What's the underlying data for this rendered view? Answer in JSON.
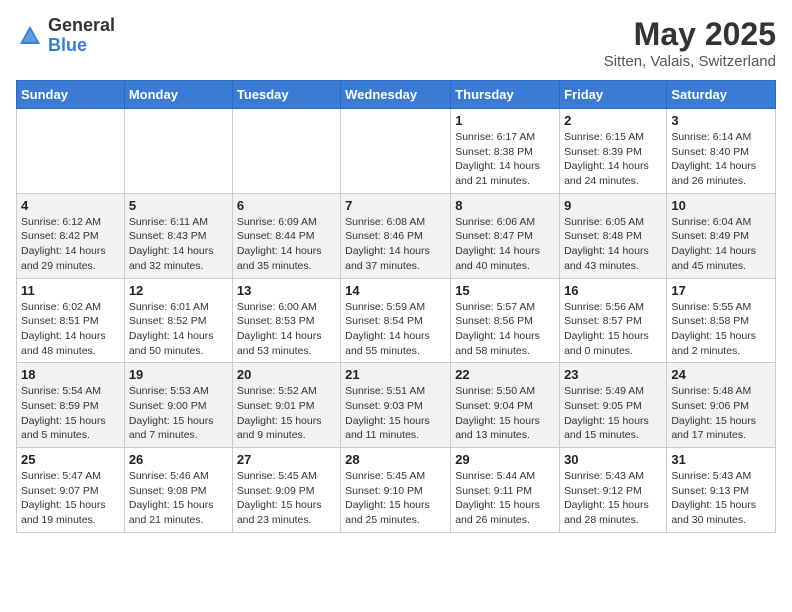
{
  "logo": {
    "general": "General",
    "blue": "Blue"
  },
  "title": "May 2025",
  "subtitle": "Sitten, Valais, Switzerland",
  "days_of_week": [
    "Sunday",
    "Monday",
    "Tuesday",
    "Wednesday",
    "Thursday",
    "Friday",
    "Saturday"
  ],
  "weeks": [
    [
      {
        "num": "",
        "detail": ""
      },
      {
        "num": "",
        "detail": ""
      },
      {
        "num": "",
        "detail": ""
      },
      {
        "num": "",
        "detail": ""
      },
      {
        "num": "1",
        "detail": "Sunrise: 6:17 AM\nSunset: 8:38 PM\nDaylight: 14 hours and 21 minutes."
      },
      {
        "num": "2",
        "detail": "Sunrise: 6:15 AM\nSunset: 8:39 PM\nDaylight: 14 hours and 24 minutes."
      },
      {
        "num": "3",
        "detail": "Sunrise: 6:14 AM\nSunset: 8:40 PM\nDaylight: 14 hours and 26 minutes."
      }
    ],
    [
      {
        "num": "4",
        "detail": "Sunrise: 6:12 AM\nSunset: 8:42 PM\nDaylight: 14 hours and 29 minutes."
      },
      {
        "num": "5",
        "detail": "Sunrise: 6:11 AM\nSunset: 8:43 PM\nDaylight: 14 hours and 32 minutes."
      },
      {
        "num": "6",
        "detail": "Sunrise: 6:09 AM\nSunset: 8:44 PM\nDaylight: 14 hours and 35 minutes."
      },
      {
        "num": "7",
        "detail": "Sunrise: 6:08 AM\nSunset: 8:46 PM\nDaylight: 14 hours and 37 minutes."
      },
      {
        "num": "8",
        "detail": "Sunrise: 6:06 AM\nSunset: 8:47 PM\nDaylight: 14 hours and 40 minutes."
      },
      {
        "num": "9",
        "detail": "Sunrise: 6:05 AM\nSunset: 8:48 PM\nDaylight: 14 hours and 43 minutes."
      },
      {
        "num": "10",
        "detail": "Sunrise: 6:04 AM\nSunset: 8:49 PM\nDaylight: 14 hours and 45 minutes."
      }
    ],
    [
      {
        "num": "11",
        "detail": "Sunrise: 6:02 AM\nSunset: 8:51 PM\nDaylight: 14 hours and 48 minutes."
      },
      {
        "num": "12",
        "detail": "Sunrise: 6:01 AM\nSunset: 8:52 PM\nDaylight: 14 hours and 50 minutes."
      },
      {
        "num": "13",
        "detail": "Sunrise: 6:00 AM\nSunset: 8:53 PM\nDaylight: 14 hours and 53 minutes."
      },
      {
        "num": "14",
        "detail": "Sunrise: 5:59 AM\nSunset: 8:54 PM\nDaylight: 14 hours and 55 minutes."
      },
      {
        "num": "15",
        "detail": "Sunrise: 5:57 AM\nSunset: 8:56 PM\nDaylight: 14 hours and 58 minutes."
      },
      {
        "num": "16",
        "detail": "Sunrise: 5:56 AM\nSunset: 8:57 PM\nDaylight: 15 hours and 0 minutes."
      },
      {
        "num": "17",
        "detail": "Sunrise: 5:55 AM\nSunset: 8:58 PM\nDaylight: 15 hours and 2 minutes."
      }
    ],
    [
      {
        "num": "18",
        "detail": "Sunrise: 5:54 AM\nSunset: 8:59 PM\nDaylight: 15 hours and 5 minutes."
      },
      {
        "num": "19",
        "detail": "Sunrise: 5:53 AM\nSunset: 9:00 PM\nDaylight: 15 hours and 7 minutes."
      },
      {
        "num": "20",
        "detail": "Sunrise: 5:52 AM\nSunset: 9:01 PM\nDaylight: 15 hours and 9 minutes."
      },
      {
        "num": "21",
        "detail": "Sunrise: 5:51 AM\nSunset: 9:03 PM\nDaylight: 15 hours and 11 minutes."
      },
      {
        "num": "22",
        "detail": "Sunrise: 5:50 AM\nSunset: 9:04 PM\nDaylight: 15 hours and 13 minutes."
      },
      {
        "num": "23",
        "detail": "Sunrise: 5:49 AM\nSunset: 9:05 PM\nDaylight: 15 hours and 15 minutes."
      },
      {
        "num": "24",
        "detail": "Sunrise: 5:48 AM\nSunset: 9:06 PM\nDaylight: 15 hours and 17 minutes."
      }
    ],
    [
      {
        "num": "25",
        "detail": "Sunrise: 5:47 AM\nSunset: 9:07 PM\nDaylight: 15 hours and 19 minutes."
      },
      {
        "num": "26",
        "detail": "Sunrise: 5:46 AM\nSunset: 9:08 PM\nDaylight: 15 hours and 21 minutes."
      },
      {
        "num": "27",
        "detail": "Sunrise: 5:45 AM\nSunset: 9:09 PM\nDaylight: 15 hours and 23 minutes."
      },
      {
        "num": "28",
        "detail": "Sunrise: 5:45 AM\nSunset: 9:10 PM\nDaylight: 15 hours and 25 minutes."
      },
      {
        "num": "29",
        "detail": "Sunrise: 5:44 AM\nSunset: 9:11 PM\nDaylight: 15 hours and 26 minutes."
      },
      {
        "num": "30",
        "detail": "Sunrise: 5:43 AM\nSunset: 9:12 PM\nDaylight: 15 hours and 28 minutes."
      },
      {
        "num": "31",
        "detail": "Sunrise: 5:43 AM\nSunset: 9:13 PM\nDaylight: 15 hours and 30 minutes."
      }
    ]
  ]
}
